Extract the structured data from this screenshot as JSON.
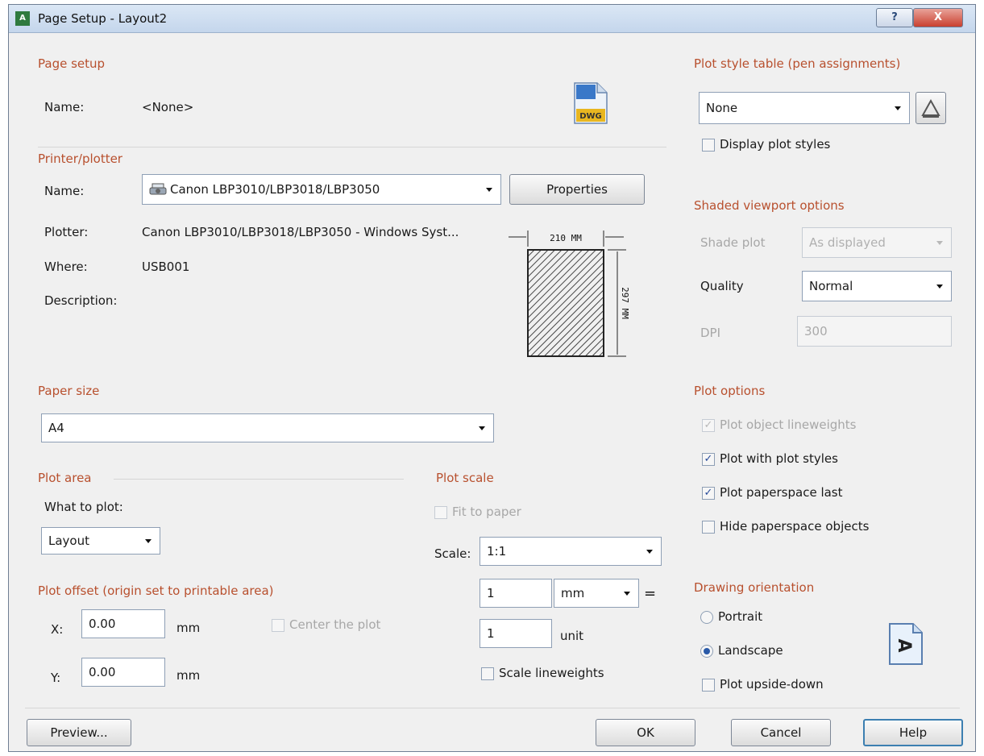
{
  "window": {
    "title": "Page Setup - Layout2",
    "help_glyph": "?",
    "close_glyph": "X"
  },
  "page_setup": {
    "header": "Page setup",
    "name_label": "Name:",
    "name_value": "<None>",
    "icon": "dwg-file-icon",
    "icon_text": "DWG"
  },
  "printer": {
    "header": "Printer/plotter",
    "name_label": "Name:",
    "name_value": "Canon LBP3010/LBP3018/LBP3050",
    "properties_label": "Properties",
    "plotter_label": "Plotter:",
    "plotter_value": "Canon LBP3010/LBP3018/LBP3050 - Windows Syst...",
    "where_label": "Where:",
    "where_value": "USB001",
    "description_label": "Description:",
    "paper_width": "210 MM",
    "paper_height": "297 MM"
  },
  "paper_size": {
    "header": "Paper size",
    "value": "A4"
  },
  "plot_area": {
    "header": "Plot area",
    "what_label": "What to plot:",
    "what_value": "Layout"
  },
  "plot_offset": {
    "header": "Plot offset (origin set to printable area)",
    "x_label": "X:",
    "x_value": "0.00",
    "x_unit": "mm",
    "y_label": "Y:",
    "y_value": "0.00",
    "y_unit": "mm",
    "center_label": "Center the plot"
  },
  "plot_scale": {
    "header": "Plot scale",
    "fit_label": "Fit to paper",
    "scale_label": "Scale:",
    "scale_value": "1:1",
    "mm_value": "1",
    "mm_unit": "mm",
    "equals": "=",
    "unit_value": "1",
    "unit_label": "unit",
    "scale_lineweights_label": "Scale lineweights"
  },
  "plot_style_table": {
    "header": "Plot style table (pen assignments)",
    "value": "None",
    "display_label": "Display plot styles"
  },
  "shaded_viewport": {
    "header": "Shaded viewport options",
    "shade_label": "Shade plot",
    "shade_value": "As displayed",
    "quality_label": "Quality",
    "quality_value": "Normal",
    "dpi_label": "DPI",
    "dpi_value": "300"
  },
  "plot_options": {
    "header": "Plot options",
    "opt1": "Plot object lineweights",
    "opt2": "Plot with plot styles",
    "opt3": "Plot paperspace last",
    "opt4": "Hide paperspace objects"
  },
  "orientation": {
    "header": "Drawing orientation",
    "portrait": "Portrait",
    "landscape": "Landscape",
    "upside": "Plot upside-down",
    "icon_glyph": "A"
  },
  "buttons": {
    "preview": "Preview...",
    "ok": "OK",
    "cancel": "Cancel",
    "help": "Help"
  },
  "colors": {
    "section_header": "#b8502e",
    "dialog_bg": "#f0f0f0",
    "accent": "#3c7fb1"
  }
}
